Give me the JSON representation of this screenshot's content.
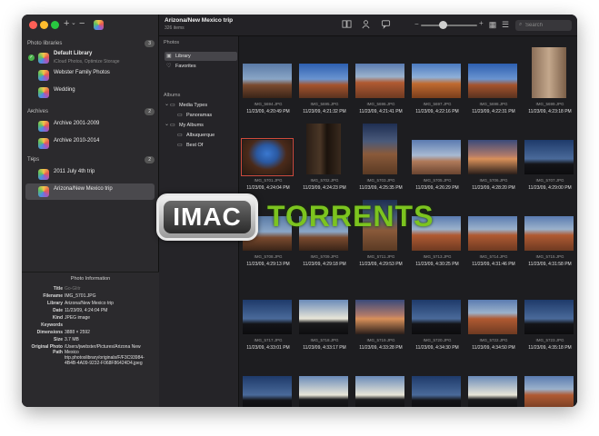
{
  "window": {
    "colors": {
      "close": "#fe5f57",
      "minimize": "#febc2e",
      "zoom": "#28c840"
    },
    "toolbar_glyphs": {
      "add": "+",
      "add_chevron": "⌄",
      "remove": "−"
    }
  },
  "sidebar": {
    "sections": [
      {
        "label": "Photo libraries",
        "count": "3",
        "items": [
          {
            "name": "Default Library",
            "subtitle": "iCloud Photos, Optimize Storage",
            "active": true
          },
          {
            "name": "Webster Family Photos"
          },
          {
            "name": "Wedding"
          }
        ]
      },
      {
        "label": "Archives",
        "count": "2",
        "items": [
          {
            "name": "Archive 2001-2009"
          },
          {
            "name": "Archive 2010-2014"
          }
        ]
      },
      {
        "label": "Trips",
        "count": "2",
        "items": [
          {
            "name": "2011 July 4th trip"
          },
          {
            "name": "Arizona/New Mexico trip",
            "selected": true
          }
        ]
      }
    ]
  },
  "info_panel": {
    "title": "Photo Information",
    "rows": [
      {
        "key": "Title",
        "value": "Go-Glitr",
        "muted": true
      },
      {
        "key": "Filename",
        "value": "IMG_5701.JPG"
      },
      {
        "key": "Library",
        "value": "Arizona/New Mexico trip"
      },
      {
        "key": "Date",
        "value": "11/23/09, 4:24:04 PM"
      },
      {
        "key": "Kind",
        "value": "JPEG image"
      },
      {
        "key": "Keywords",
        "value": ""
      },
      {
        "key": "Dimensions",
        "value": "3888 × 2592"
      },
      {
        "key": "Size",
        "value": "3.7 MB"
      },
      {
        "key": "Original Photo Path",
        "value": "/Users/jwebster/Pictures/Arizona New Mexico trip.photoslibrary/originals/F/F3C93984-4B4B-4A09-9232-F068F86424D4.jpeg"
      }
    ]
  },
  "header": {
    "title": "Arizona/New Mexico trip",
    "subtitle": "326 items",
    "zoom_level": 0.4,
    "search_placeholder": "Search",
    "icons": {
      "search": "⌕",
      "grid_view": "▦",
      "list_view": "☰"
    }
  },
  "nav": {
    "photos_heading": "Photos",
    "photos": [
      {
        "label": "Library",
        "icon": "library-icon",
        "glyph": "▣",
        "selected": true
      },
      {
        "label": "Favorites",
        "icon": "heart-icon",
        "glyph": "♡"
      }
    ],
    "albums_heading": "Albums",
    "albums": [
      {
        "label": "Media Types",
        "icon": "folder-icon",
        "glyph": "▭",
        "level": 0,
        "disclosure": "⌄"
      },
      {
        "label": "Panoramas",
        "icon": "album-icon",
        "glyph": "▭",
        "level": 1
      },
      {
        "label": "My Albums",
        "icon": "folder-icon",
        "glyph": "▭",
        "level": 0,
        "disclosure": "⌄"
      },
      {
        "label": "Albuquerque",
        "icon": "album-icon",
        "glyph": "▭",
        "level": 1
      },
      {
        "label": "Best Of",
        "icon": "album-icon",
        "glyph": "▭",
        "level": 1
      }
    ]
  },
  "photos": [
    {
      "name": "IMG_5694.JPG",
      "date": "11/23/09, 4:20:49 PM",
      "scene": "dusk-ruin"
    },
    {
      "name": "IMG_5695.JPG",
      "date": "11/23/09, 4:21:32 PM",
      "scene": "blue-ruin"
    },
    {
      "name": "IMG_5696.JPG",
      "date": "11/23/09, 4:21:41 PM",
      "scene": "red-ruin"
    },
    {
      "name": "IMG_5697.JPG",
      "date": "11/23/09, 4:22:16 PM",
      "scene": "orange-ruin"
    },
    {
      "name": "IMG_5698.JPG",
      "date": "11/23/09, 4:22:31 PM",
      "scene": "blue-ruin"
    },
    {
      "name": "IMG_5699.JPG",
      "date": "11/23/09, 4:23:18 PM",
      "scene": "wall-portrait"
    },
    {
      "name": "IMG_5701.JPG",
      "date": "11/23/09, 4:24:04 PM",
      "scene": "window",
      "selected": true
    },
    {
      "name": "IMG_5702.JPG",
      "date": "11/23/09, 4:24:23 PM",
      "scene": "dark-doorway"
    },
    {
      "name": "IMG_5703.JPG",
      "date": "11/23/09, 4:25:35 PM",
      "scene": "tower"
    },
    {
      "name": "IMG_5705.JPG",
      "date": "11/23/09, 4:26:29 PM",
      "scene": "cloud-ruin"
    },
    {
      "name": "IMG_5706.JPG",
      "date": "11/23/09, 4:28:20 PM",
      "scene": "sunset-plain"
    },
    {
      "name": "IMG_5707.JPG",
      "date": "11/23/09, 4:29:00 PM",
      "scene": "dark-silhouette"
    },
    {
      "name": "IMG_5708.JPG",
      "date": "11/23/09, 4:29:13 PM",
      "scene": "dusk-ruin"
    },
    {
      "name": "IMG_5709.JPG",
      "date": "11/23/09, 4:29:18 PM",
      "scene": "dusk-ruin"
    },
    {
      "name": "IMG_5711.JPG",
      "date": "11/23/09, 4:29:53 PM",
      "scene": "tower"
    },
    {
      "name": "IMG_5713.JPG",
      "date": "11/23/09, 4:30:25 PM",
      "scene": "red-ruin"
    },
    {
      "name": "IMG_5714.JPG",
      "date": "11/23/09, 4:31:46 PM",
      "scene": "red-ruin"
    },
    {
      "name": "IMG_5715.JPG",
      "date": "11/23/09, 4:31:58 PM",
      "scene": "red-ruin"
    },
    {
      "name": "IMG_5717.JPG",
      "date": "11/23/09, 4:33:01 PM",
      "scene": "dark-silhouette"
    },
    {
      "name": "IMG_5718.JPG",
      "date": "11/23/09, 4:33:17 PM",
      "scene": "bright-silhouette"
    },
    {
      "name": "IMG_5719.JPG",
      "date": "11/23/09, 4:33:28 PM",
      "scene": "sunset-plain"
    },
    {
      "name": "IMG_5720.JPG",
      "date": "11/23/09, 4:34:30 PM",
      "scene": "dark-silhouette"
    },
    {
      "name": "IMG_5722.JPG",
      "date": "11/23/09, 4:34:50 PM",
      "scene": "red-ruin"
    },
    {
      "name": "IMG_5723.JPG",
      "date": "11/23/09, 4:35:18 PM",
      "scene": "dark-silhouette"
    },
    {
      "name": "",
      "date": "",
      "scene": "dark-silhouette"
    },
    {
      "name": "",
      "date": "",
      "scene": "bright-silhouette"
    },
    {
      "name": "",
      "date": "",
      "scene": "bright-silhouette"
    },
    {
      "name": "",
      "date": "",
      "scene": "dark-silhouette"
    },
    {
      "name": "",
      "date": "",
      "scene": "bright-silhouette"
    },
    {
      "name": "",
      "date": "",
      "scene": "red-ruin"
    }
  ],
  "scene_styles": {
    "dusk-ruin": "linear-gradient(180deg,#5a7aa6 0%,#8aa6c6 45%,#7a4a2e 62%,#3a2418 100%)",
    "blue-ruin": "linear-gradient(180deg,#2d5fb0 0%,#6a94d0 45%,#a5532c 62%,#5a3220 100%)",
    "red-ruin": "linear-gradient(180deg,#5a7bb0 0%,#9bb2cc 38%,#b05a32 55%,#6e3a22 100%)",
    "orange-ruin": "linear-gradient(180deg,#4a7ac0 0%,#8fb0d8 40%,#c06a30 58%,#7a3e1c 100%)",
    "wall-portrait": "linear-gradient(90deg,#8a6e58 0%,#c4a88c 50%,#7a5e48 100%)",
    "window": "radial-gradient(ellipse at 50% 40%,#3a78d0 0%,#2a58a0 30%,#4a2a1a 55%,#2a1a10 100%)",
    "dark-doorway": "linear-gradient(90deg,#2a1e16 0%,#4a3626 40%,#1a120c 60%,#3a2a1e 100%)",
    "tower": "linear-gradient(180deg,#1e2e52 0%,#4a5a7a 35%,#8a5a3a 60%,#5a3a24 100%)",
    "cloud-ruin": "linear-gradient(180deg,#5a7ab0 0%,#a8bad2 45%,#b07a5a 62%,#6a4430 100%)",
    "sunset-plain": "linear-gradient(180deg,#3a4a7a 0%,#b07a6a 45%,#d8905a 55%,#2a1e1a 100%)",
    "dark-silhouette": "linear-gradient(180deg,#1e3a6a 0%,#4a6a9a 55%,#141418 70%,#0c0c0e 100%)",
    "bright-silhouette": "linear-gradient(180deg,#6a8ab8 0%,#e8e6d8 55%,#1a1a1c 68%,#0e0e10 100%)"
  },
  "watermark": {
    "left": "IMAC",
    "right": "TORRENTS"
  }
}
